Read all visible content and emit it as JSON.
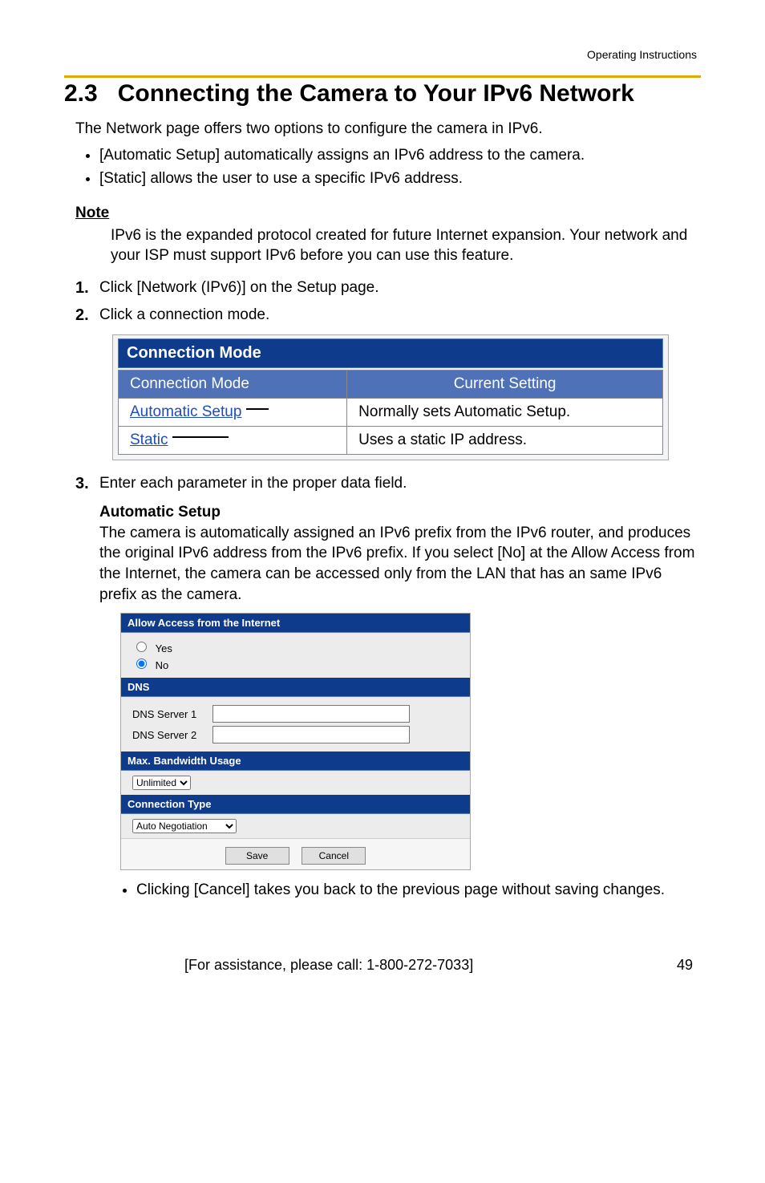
{
  "header": {
    "doc_title": "Operating Instructions"
  },
  "section": {
    "number": "2.3",
    "title": "Connecting the Camera to Your IPv6 Network",
    "intro": "The Network page offers two options to configure the camera in IPv6.",
    "bullets": [
      "[Automatic Setup] automatically assigns an IPv6 address to the camera.",
      "[Static] allows the user to use a specific IPv6 address."
    ]
  },
  "note": {
    "label": "Note",
    "body": "IPv6 is the expanded protocol created for future Internet expansion. Your network and your ISP must support IPv6 before you can use this feature."
  },
  "steps": {
    "s1": "Click [Network (IPv6)] on the Setup page.",
    "s2": "Click a connection mode.",
    "s3": "Enter each parameter in the proper data field."
  },
  "connection_mode": {
    "panel_title": "Connection Mode",
    "col_mode": "Connection Mode",
    "col_current": "Current Setting",
    "rows": [
      {
        "mode": "Automatic Setup",
        "desc": "Normally sets Automatic Setup."
      },
      {
        "mode": "Static",
        "desc": "Uses a static IP address."
      }
    ]
  },
  "auto_setup": {
    "title": "Automatic Setup",
    "body": "The camera is automatically assigned an IPv6 prefix from the IPv6 router, and produces the original IPv6 address from the IPv6 prefix. If you select [No] at the Allow Access from the Internet, the camera can be accessed only from the LAN that has an same IPv6 prefix as the camera."
  },
  "inner_panel": {
    "allow_access": "Allow Access from the Internet",
    "yes": "Yes",
    "no": "No",
    "allow_selected": "No",
    "dns": "DNS",
    "dns1_label": "DNS Server 1",
    "dns1_value": "",
    "dns2_label": "DNS Server 2",
    "dns2_value": "",
    "bw": "Max. Bandwidth Usage",
    "bw_value": "Unlimited",
    "ctype": "Connection Type",
    "ctype_value": "Auto Negotiation",
    "save": "Save",
    "cancel": "Cancel"
  },
  "cancel_note": "Clicking [Cancel] takes you back to the previous page without saving changes.",
  "footer": {
    "assist": "[For assistance, please call: 1-800-272-7033]",
    "page": "49"
  }
}
